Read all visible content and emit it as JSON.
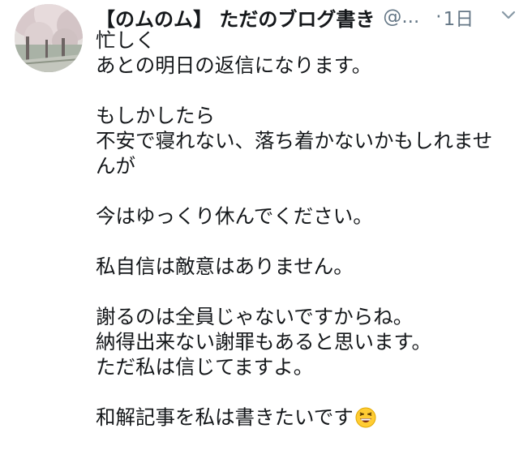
{
  "tweet": {
    "author_name": "【のムのム】 ただのブログ書き",
    "handle": "@...",
    "separator": "·",
    "time": "1日",
    "lines": [
      "忙しく",
      "あとの明日の返信になります。",
      "",
      "もしかしたら",
      "不安で寝れない、落ち着かないかもしれませ",
      "んが",
      "",
      "今はゆっくり休んでください。",
      "",
      "私自信は敵意はありません。",
      "",
      "謝るのは全員じゃないですからね。",
      "納得出来ない謝罪もあると思います。",
      "ただ私は信じてますよ。",
      "",
      "和解記事を私は書きたいです"
    ],
    "trailing_emoji": "grinning-squinting-face-emoji",
    "icons": {
      "avatar": "cherry-blossom-avatar",
      "menu": "chevron-down-icon"
    }
  }
}
